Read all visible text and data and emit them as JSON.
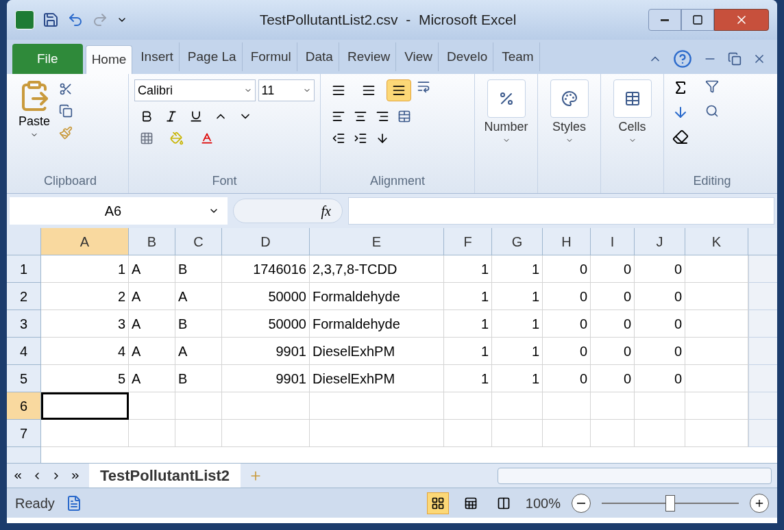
{
  "window": {
    "title": "TestPollutantList2.csv  -  Microsoft Excel"
  },
  "tabs": [
    {
      "label": "File",
      "kind": "file",
      "selected": false
    },
    {
      "label": "Home",
      "kind": "tab",
      "selected": true
    },
    {
      "label": "Insert",
      "kind": "tab",
      "selected": false
    },
    {
      "label": "Page La",
      "kind": "tab",
      "selected": false
    },
    {
      "label": "Formul",
      "kind": "tab",
      "selected": false
    },
    {
      "label": "Data",
      "kind": "tab",
      "selected": false
    },
    {
      "label": "Review",
      "kind": "tab",
      "selected": false
    },
    {
      "label": "View",
      "kind": "tab",
      "selected": false
    },
    {
      "label": "Develo",
      "kind": "tab",
      "selected": false
    },
    {
      "label": "Team",
      "kind": "tab",
      "selected": false
    }
  ],
  "ribbon": {
    "paste_label": "Paste",
    "font_name": "Calibri",
    "font_size": "11",
    "number_label": "Number",
    "styles_label": "Styles",
    "cells_label": "Cells",
    "vertical_align": [
      {
        "selected": false
      },
      {
        "selected": false
      },
      {
        "selected": true
      }
    ],
    "groups": [
      "Clipboard",
      "Font",
      "Alignment",
      "Editing"
    ]
  },
  "formula_bar": {
    "name_box": "A6",
    "fx": "fx"
  },
  "columns": [
    {
      "label": "A",
      "kind": "number",
      "selected": true
    },
    {
      "label": "B",
      "kind": "text",
      "selected": false
    },
    {
      "label": "C",
      "kind": "text",
      "selected": false
    },
    {
      "label": "D",
      "kind": "number",
      "selected": false
    },
    {
      "label": "E",
      "kind": "text",
      "selected": false
    },
    {
      "label": "F",
      "kind": "number",
      "selected": false
    },
    {
      "label": "G",
      "kind": "number",
      "selected": false
    },
    {
      "label": "H",
      "kind": "number",
      "selected": false
    },
    {
      "label": "I",
      "kind": "number",
      "selected": false
    },
    {
      "label": "J",
      "kind": "number",
      "selected": false
    },
    {
      "label": "K",
      "kind": "text",
      "selected": false
    }
  ],
  "rows": [
    {
      "label": "1",
      "selected": false,
      "cells": [
        "1",
        "A",
        "B",
        "1746016",
        "2,3,7,8-TCDD",
        "1",
        "1",
        "0",
        "0",
        "0"
      ]
    },
    {
      "label": "2",
      "selected": false,
      "cells": [
        "2",
        "A",
        "A",
        "50000",
        "Formaldehyde",
        "1",
        "1",
        "0",
        "0",
        "0"
      ]
    },
    {
      "label": "3",
      "selected": false,
      "cells": [
        "3",
        "A",
        "B",
        "50000",
        "Formaldehyde",
        "1",
        "1",
        "0",
        "0",
        "0"
      ]
    },
    {
      "label": "4",
      "selected": false,
      "cells": [
        "4",
        "A",
        "A",
        "9901",
        "DieselExhPM",
        "1",
        "1",
        "0",
        "0",
        "0"
      ]
    },
    {
      "label": "5",
      "selected": false,
      "cells": [
        "5",
        "A",
        "B",
        "9901",
        "DieselExhPM",
        "1",
        "1",
        "0",
        "0",
        "0"
      ]
    },
    {
      "label": "6",
      "selected": true,
      "cells": []
    },
    {
      "label": "7",
      "selected": false,
      "cells": []
    }
  ],
  "sheet_tabs": [
    {
      "label": "TestPollutantList2",
      "selected": true
    }
  ],
  "status_bar": {
    "status": "Ready",
    "views": [
      {
        "selected": true
      },
      {
        "selected": false
      },
      {
        "selected": false
      }
    ],
    "zoom": "100%",
    "zoom_slider": {
      "level": 0.5
    }
  }
}
